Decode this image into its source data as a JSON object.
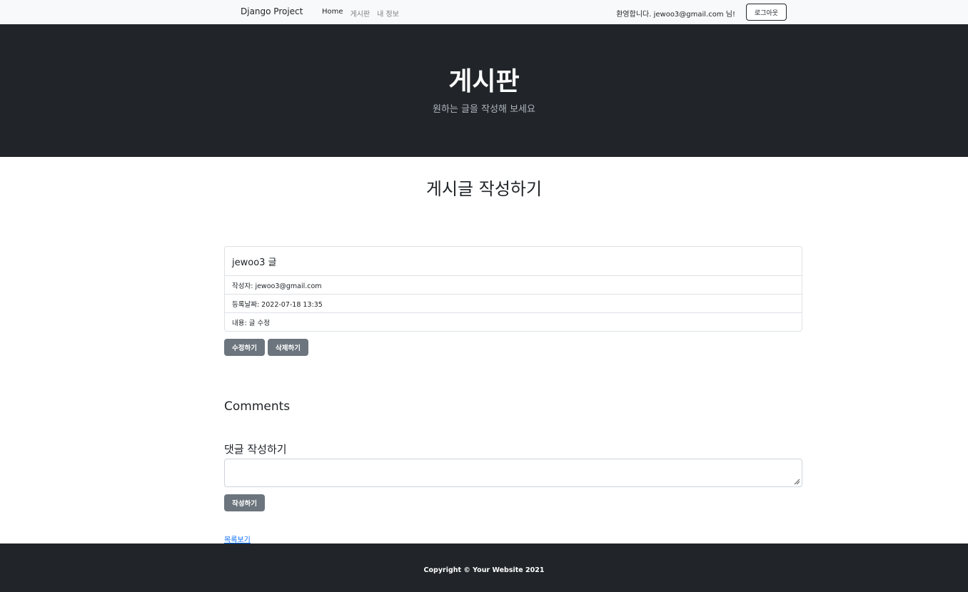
{
  "navbar": {
    "brand": "Django Project",
    "links": [
      {
        "label": "Home"
      },
      {
        "label": "게시판"
      },
      {
        "label": "내 정보"
      }
    ],
    "welcome": "환영합니다. jewoo3@gmail.com 님!",
    "logout_label": "로그아웃"
  },
  "hero": {
    "title": "게시판",
    "subtitle": "원하는 글을 작성해 보세요"
  },
  "main": {
    "page_title": "게시글 작성하기",
    "post": {
      "title": "jewoo3 글",
      "author": "작성자: jewoo3@gmail.com",
      "date": "등록날짜: 2022-07-18 13:35",
      "content": "내용: 글 수정"
    },
    "edit_label": "수정하기",
    "delete_label": "삭제하기",
    "comments_heading": "Comments",
    "comment_form_label": "댓글 작성하기",
    "comment_value": "",
    "submit_label": "작성하기",
    "list_link": "목록보기"
  },
  "footer": {
    "copyright": "Copyright © Your Website 2021"
  },
  "colors": {
    "dark": "#212529",
    "button_grey": "#6c757d",
    "link_blue": "#0d6efd",
    "navbar_bg": "#f8f9fa"
  }
}
